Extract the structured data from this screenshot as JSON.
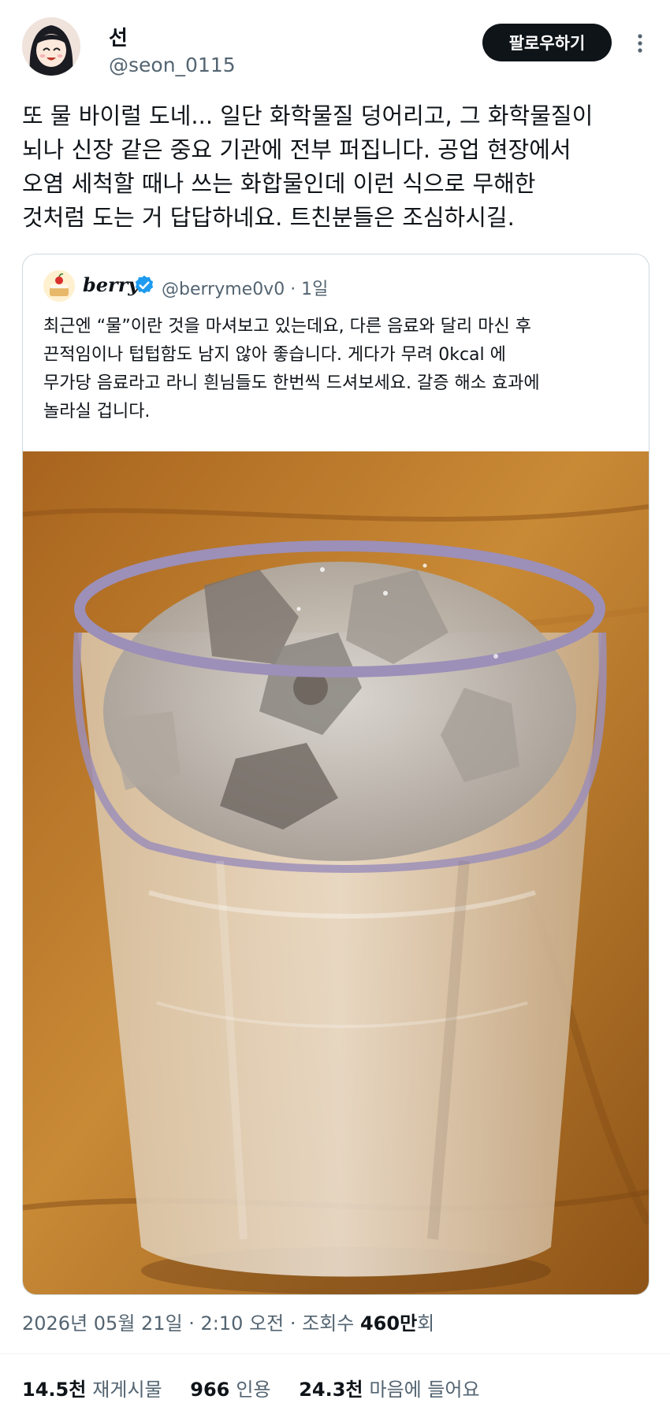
{
  "author": {
    "display_name": "선",
    "handle": "@seon_0115",
    "avatar_icon": "anime-girl-avatar"
  },
  "follow_button_label": "팔로우하기",
  "more_icon": "more-vertical-icon",
  "tweet": {
    "lines": [
      "또 물 바이럴 도네... 일단 화학물질 덩어리고, 그 화학물질이",
      "뇌나 신장 같은 중요 기관에 전부 퍼집니다.  공업 현장에서",
      "오염 세척할 때나 쓰는 화합물인데 이런 식으로 무해한",
      "것처럼 도는 거 답답하네요. 트친분들은 조심하시길."
    ]
  },
  "quote": {
    "display_name": "berry",
    "handle_and_time": "@berryme0v0 · 1일",
    "avatar_icon": "cake-avatar",
    "verified_icon": "verified-badge-icon",
    "lines": [
      "최근엔 “물”이란 것을 마셔보고 있는데요, 다른 음료와 달리 마신 후",
      "끈적임이나 텁텁함도 남지 않아 좋습니다. 게다가 무려 0kcal 에",
      "무가당 음료라고 라니 흰님들도 한번씩 드셔보세요. 갈증 해소 효과에",
      "놀라실 겁니다."
    ],
    "photo": "glass-of-ice-water-on-wooden-table"
  },
  "meta": {
    "datetime": "2026년 05월 21일 · 2:10 오전 · 조회수 ",
    "views": "460만",
    "views_suffix": "회"
  },
  "stats": {
    "retweets_count": "14.5천",
    "retweets_label": "재게시물",
    "quotes_count": "966",
    "quotes_label": "인용",
    "likes_count": "24.3천",
    "likes_label": "마음에 들어요"
  },
  "colors": {
    "text": "#0f1419",
    "secondary": "#536471",
    "border": "#cfd9de",
    "verified": "#1d9bf0",
    "button": "#0f1419"
  }
}
